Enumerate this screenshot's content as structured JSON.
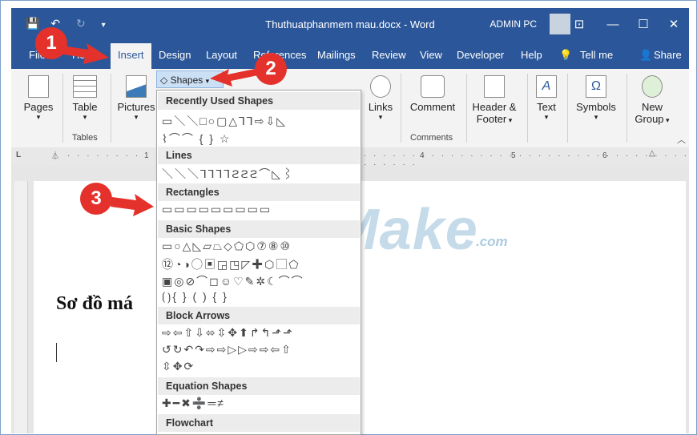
{
  "window": {
    "title": "Thuthuatphanmem mau.docx - Word",
    "user": "ADMIN PC"
  },
  "tabs": [
    "File",
    "Home",
    "Insert",
    "Design",
    "Layout",
    "References",
    "Mailings",
    "Review",
    "View",
    "Developer",
    "Help",
    "Tell me",
    "Share"
  ],
  "active_tab": "Insert",
  "ribbon": {
    "pages": "Pages",
    "table": "Table",
    "tables_group": "Tables",
    "pictures": "Pictures",
    "shapes": "Shapes",
    "links": "Links",
    "comment": "Comment",
    "comments_group": "Comments",
    "header_footer_1": "Header &",
    "header_footer_2": "Footer",
    "text": "Text",
    "symbols": "Symbols",
    "new_group_1": "New",
    "new_group_2": "Group"
  },
  "shapes_menu": {
    "sections": [
      {
        "title": "Recently Used Shapes",
        "rows": [
          "▭＼＼□○▢△⅂⅂⇨⇩◺",
          "⌇⌒⌒ { } ☆"
        ]
      },
      {
        "title": "Lines",
        "rows": [
          "＼＼＼⅂⅂⅂⅂ϩϩϩ⌒◺⌇"
        ]
      },
      {
        "title": "Rectangles",
        "rows": [
          "▭▭▭▭▭▭▭▭▭"
        ]
      },
      {
        "title": "Basic Shapes",
        "rows": [
          "▭○△◺▱⏢◇⬠⬡⑦⑧⑩",
          "⑫◔◑◯▣◲◳◸✚⬡▢⬠",
          "▣◎⊘⌒◻☺♡✎✲☾⌒⌒",
          "⟮⟯{ } ( ) { }"
        ]
      },
      {
        "title": "Block Arrows",
        "rows": [
          "⇨⇦⇧⇩⬄⇳✥⬆↱↰⬏⬏",
          "↺↻↶↷⇨⇨▷▷⇨⇨⇦⇧",
          "⇳✥⟳"
        ]
      },
      {
        "title": "Equation Shapes",
        "rows": [
          "✚━✖➗═≠"
        ]
      },
      {
        "title": "Flowchart",
        "rows": []
      }
    ]
  },
  "document": {
    "heading": "Sơ đồ má"
  },
  "ruler": {
    "marks": [
      "1",
      "4",
      "5",
      "6"
    ]
  },
  "watermark": {
    "brand": "TipsMake",
    "domain": ".com"
  },
  "callouts": [
    "1",
    "2",
    "3"
  ]
}
